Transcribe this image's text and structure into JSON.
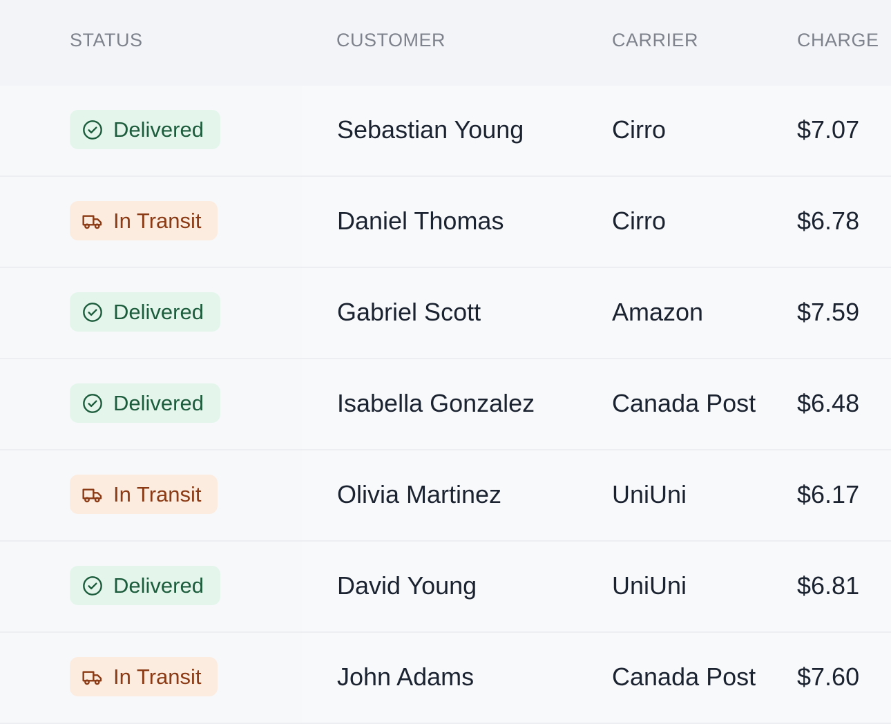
{
  "columns": {
    "status": "STATUS",
    "customer": "CUSTOMER",
    "carrier": "CARRIER",
    "charge": "CHARGE"
  },
  "colors": {
    "delivered_bg": "#e4f6ec",
    "delivered_text": "#1c5b3b",
    "transit_bg": "#fcecdf",
    "transit_text": "#8a3a14"
  },
  "rows": [
    {
      "status": "Delivered",
      "status_icon": "check-circle-icon",
      "customer": "Sebastian Young",
      "carrier": "Cirro",
      "charge": "$7.07"
    },
    {
      "status": "In Transit",
      "status_icon": "truck-icon",
      "customer": "Daniel Thomas",
      "carrier": "Cirro",
      "charge": "$6.78"
    },
    {
      "status": "Delivered",
      "status_icon": "check-circle-icon",
      "customer": "Gabriel Scott",
      "carrier": "Amazon",
      "charge": "$7.59"
    },
    {
      "status": "Delivered",
      "status_icon": "check-circle-icon",
      "customer": "Isabella Gonzalez",
      "carrier": "Canada Post",
      "charge": "$6.48"
    },
    {
      "status": "In Transit",
      "status_icon": "truck-icon",
      "customer": "Olivia Martinez",
      "carrier": "UniUni",
      "charge": "$6.17"
    },
    {
      "status": "Delivered",
      "status_icon": "check-circle-icon",
      "customer": "David Young",
      "carrier": "UniUni",
      "charge": "$6.81"
    },
    {
      "status": "In Transit",
      "status_icon": "truck-icon",
      "customer": "John Adams",
      "carrier": "Canada Post",
      "charge": "$7.60"
    }
  ]
}
